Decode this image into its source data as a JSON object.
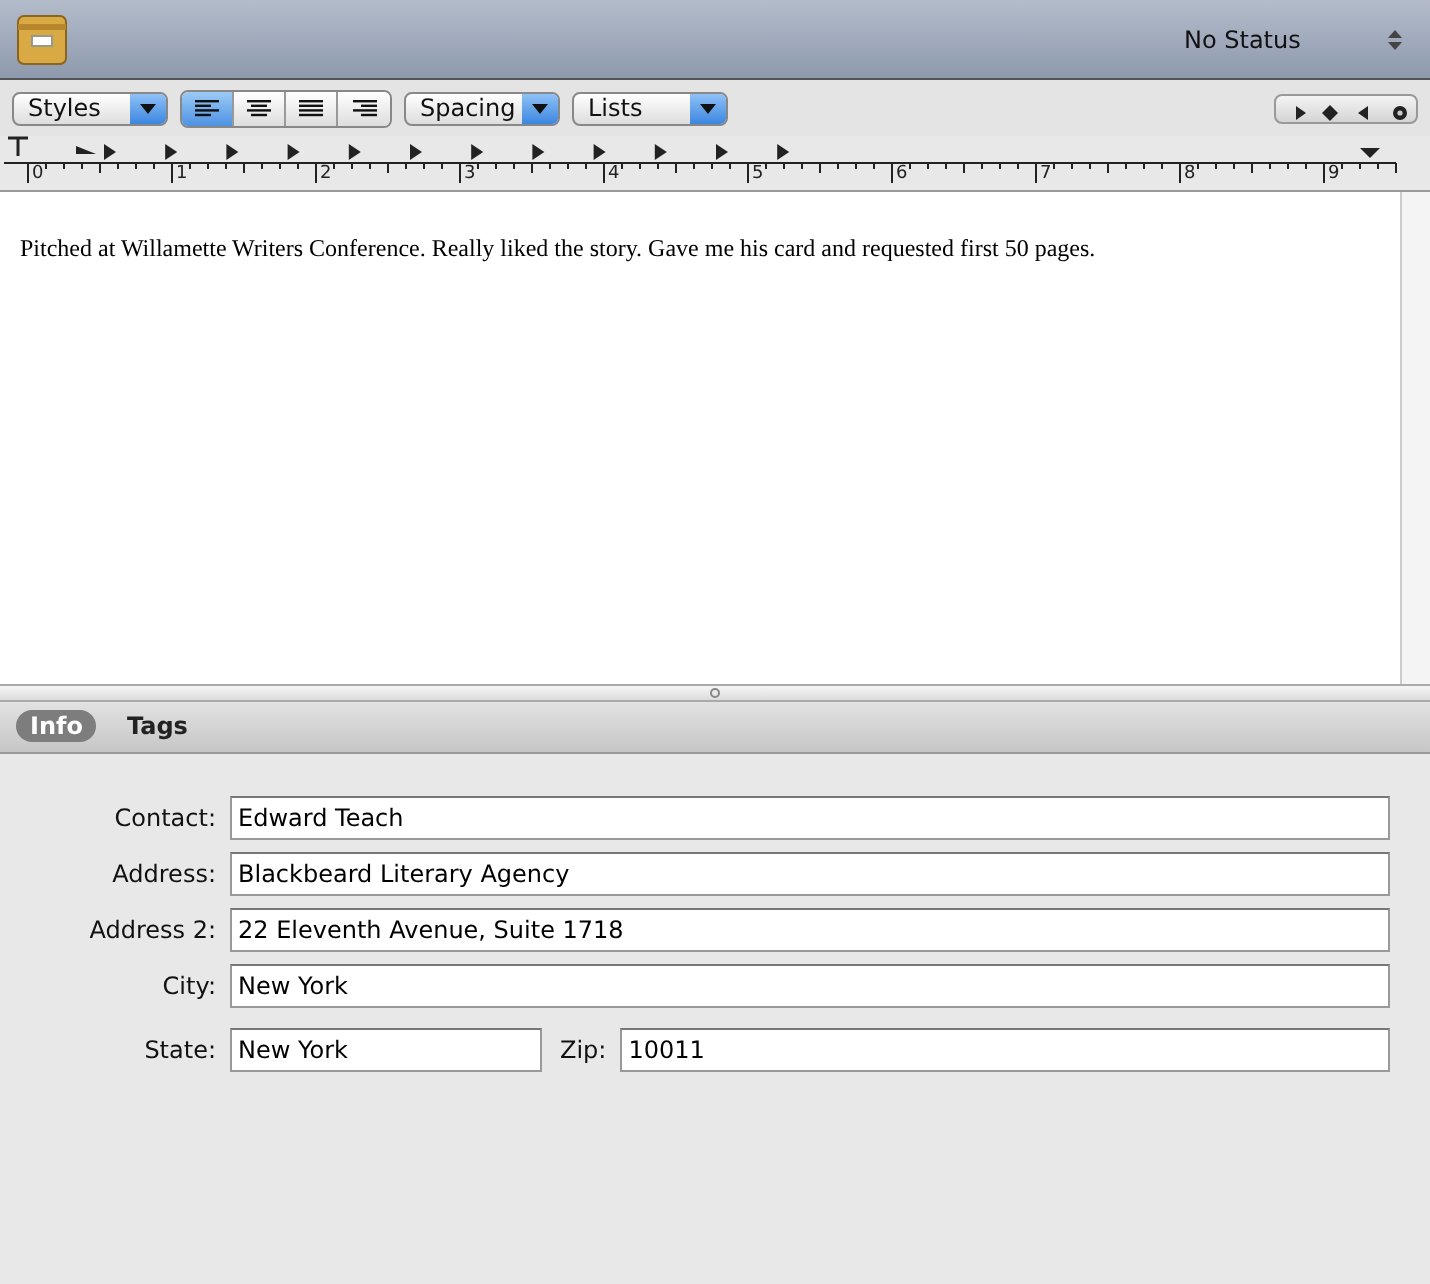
{
  "header": {
    "status": "No Status"
  },
  "toolbar": {
    "styles": "Styles",
    "alignment": [
      {
        "kind": "left",
        "selected": true
      },
      {
        "kind": "center",
        "selected": false
      },
      {
        "kind": "justify",
        "selected": false
      },
      {
        "kind": "right",
        "selected": false
      }
    ],
    "spacing": "Spacing",
    "lists": "Lists"
  },
  "ruler": {
    "numbers": [
      "0",
      "1",
      "2",
      "3",
      "4",
      "5",
      "6",
      "7",
      "8",
      "9"
    ]
  },
  "note": "Pitched at Willamette Writers Conference. Really liked the story. Gave me his card and requested first 50 pages.",
  "tabs": [
    {
      "label": "Info",
      "selected": true
    },
    {
      "label": "Tags",
      "selected": false
    }
  ],
  "fields": [
    {
      "label": "Contact:",
      "value": "Edward Teach"
    },
    {
      "label": "Address:",
      "value": "Blackbeard Literary Agency"
    },
    {
      "label": "Address 2:",
      "value": "22 Eleventh Avenue, Suite 1718"
    },
    {
      "label": "City:",
      "value": "New York"
    }
  ],
  "state": {
    "label": "State:",
    "value": "New York"
  },
  "zip": {
    "label": "Zip:",
    "value": "10011"
  }
}
